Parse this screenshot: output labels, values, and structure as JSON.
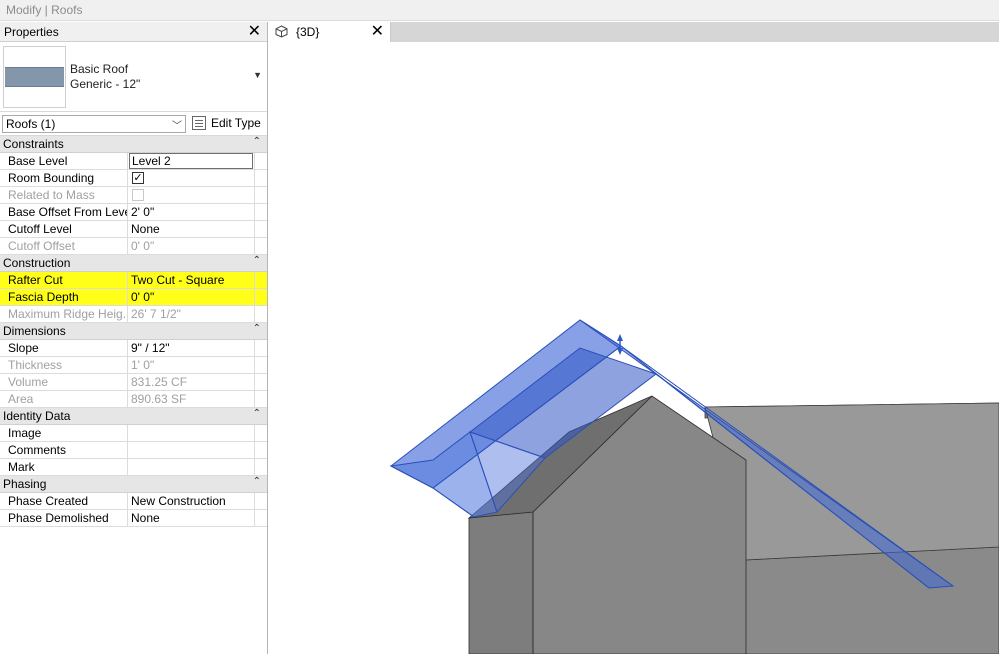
{
  "window": {
    "title": "Modify | Roofs"
  },
  "properties": {
    "title": "Properties",
    "close_glyph": "✕",
    "type": {
      "family": "Basic Roof",
      "name": "Generic - 12\""
    },
    "instance_filter": "Roofs (1)",
    "edit_type_label": "Edit Type",
    "groups": {
      "constraints": {
        "label": "Constraints",
        "rows": [
          {
            "name": "Base Level",
            "value": "Level 2"
          },
          {
            "name": "Room Bounding",
            "value": "✓"
          },
          {
            "name": "Related to Mass",
            "value": ""
          },
          {
            "name": "Base Offset From Level",
            "value": "2'  0\""
          },
          {
            "name": "Cutoff Level",
            "value": "None"
          },
          {
            "name": "Cutoff Offset",
            "value": "0'  0\""
          }
        ]
      },
      "construction": {
        "label": "Construction",
        "rows": [
          {
            "name": "Rafter Cut",
            "value": "Two Cut - Square"
          },
          {
            "name": "Fascia Depth",
            "value": "0'  0\""
          },
          {
            "name": "Maximum Ridge Heig...",
            "value": "26'  7 1/2\""
          }
        ]
      },
      "dimensions": {
        "label": "Dimensions",
        "rows": [
          {
            "name": "Slope",
            "value": "9\" / 12\""
          },
          {
            "name": "Thickness",
            "value": "1'  0\""
          },
          {
            "name": "Volume",
            "value": "831.25 CF"
          },
          {
            "name": "Area",
            "value": "890.63 SF"
          }
        ]
      },
      "identity": {
        "label": "Identity Data",
        "rows": [
          {
            "name": "Image",
            "value": ""
          },
          {
            "name": "Comments",
            "value": ""
          },
          {
            "name": "Mark",
            "value": ""
          }
        ]
      },
      "phasing": {
        "label": "Phasing",
        "rows": [
          {
            "name": "Phase Created",
            "value": "New Construction"
          },
          {
            "name": "Phase Demolished",
            "value": "None"
          }
        ]
      }
    }
  },
  "view": {
    "tab_label": "{3D}",
    "close_glyph": "✕"
  },
  "colors": {
    "highlight": "#ffff1a",
    "selection": "#3f68d6",
    "wall": "#878787"
  }
}
